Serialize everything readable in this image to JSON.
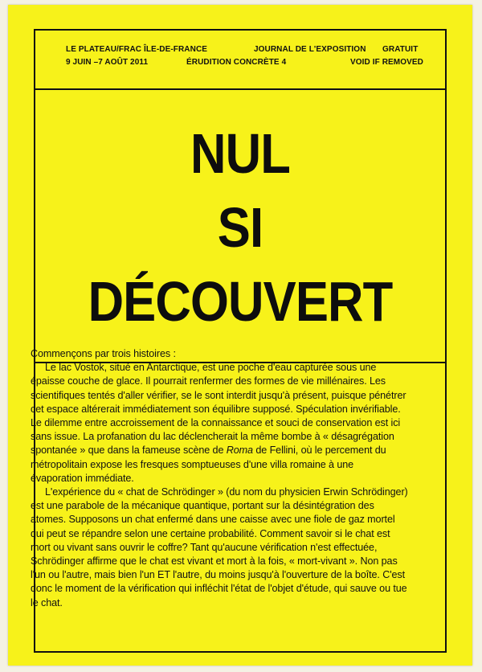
{
  "header": {
    "left_1": "LE PLATEAU/FRAC ÎLE-DE-FRANCE",
    "left_2": "9 JUIN –7 AOÛT 2011",
    "center_1": "JOURNAL DE L'EXPOSITION",
    "center_2": "ÉRUDITION CONCRÈTE 4",
    "right_1": "GRATUIT",
    "right_2": "VOID IF REMOVED"
  },
  "title": {
    "line1": "NUL",
    "line2": "SI",
    "line3": "DÉCOUVERT"
  },
  "colors": {
    "cover": "#f7f21a",
    "ink": "#111111"
  },
  "body": {
    "intro": "Commençons par trois histoires :",
    "p1": "Le lac Vostok, situé en Antarctique, est une poche d'eau capturée sous une épaisse couche de glace. Il pourrait renfermer des formes de vie millénaires. Les scientifiques tentés d'aller vérifier, se le sont interdit jusqu'à présent, puisque pénétrer cet espace altérerait immédiatement son équilibre supposé. Spéculation invérifiable. Le dilemme entre accroissement de la connaissance et souci de conservation est ici sans issue. La profanation du lac déclencherait la même bombe à « désagrégation spontanée » que dans la fameuse scène de ",
    "p1_italic": "Roma",
    "p1_end": " de Fellini, où le percement du métropolitain expose les fresques somptueuses d'une villa romaine à une évaporation immédiate.",
    "p2": "L'expérience du « chat de Schrödinger » (du nom du physicien Erwin Schrödinger) est une parabole de la mécanique quantique, portant sur la désintégration des atomes. Supposons un chat enfermé dans une caisse avec une fiole de gaz mortel qui peut se répandre selon une certaine probabilité. Comment savoir si le chat est mort ou vivant sans ouvrir le coffre? Tant qu'aucune vérification n'est effectuée, Schrödinger affirme que le chat est vivant et mort à la fois, « mort-vivant ». Non pas l'un ou l'autre, mais bien l'un ET l'autre, du moins jusqu'à l'ouverture de la boîte. C'est donc le moment de la vérification qui infléchit l'état de l'objet d'étude, qui sauve ou tue le chat."
  }
}
